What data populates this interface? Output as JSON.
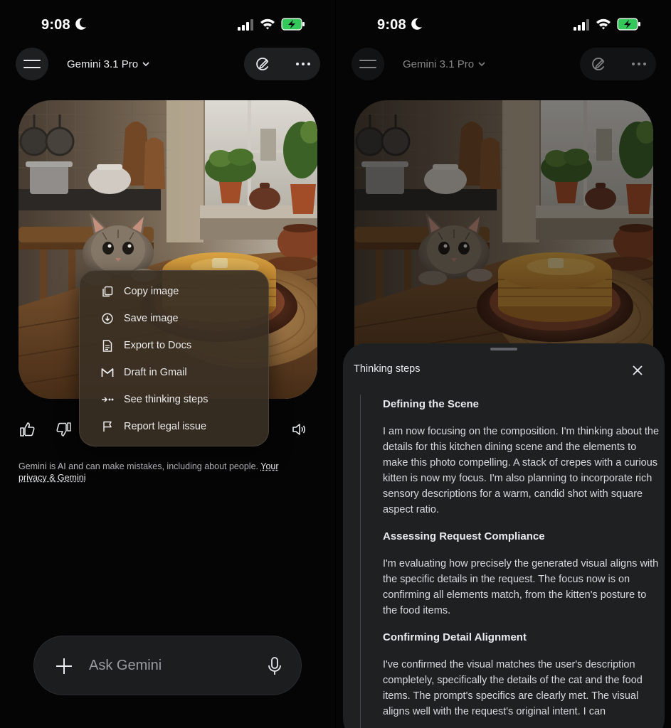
{
  "status_bar": {
    "time": "9:08"
  },
  "header": {
    "model_name": "Gemini 3.1 Pro"
  },
  "context_menu": {
    "items": [
      {
        "label": "Copy image",
        "icon": "copy-icon"
      },
      {
        "label": "Save image",
        "icon": "download-icon"
      },
      {
        "label": "Export to Docs",
        "icon": "docs-icon"
      },
      {
        "label": "Draft in Gmail",
        "icon": "gmail-icon"
      },
      {
        "label": "See thinking steps",
        "icon": "thinking-steps-icon"
      },
      {
        "label": "Report legal issue",
        "icon": "flag-icon"
      }
    ]
  },
  "disclaimer": {
    "text": "Gemini is AI and can make mistakes, including about people. ",
    "link_part1": "Your",
    "link_part2": "privacy & Gemini"
  },
  "input": {
    "placeholder": "Ask Gemini"
  },
  "thinking_sheet": {
    "title": "Thinking steps",
    "steps": [
      {
        "title": "Defining the Scene",
        "body": "I am now focusing on the composition. I'm thinking about the details for this kitchen dining scene and the elements to make this photo compelling. A stack of crepes with a curious kitten is now my focus. I'm also planning to incorporate rich sensory descriptions for a warm, candid shot with square aspect ratio."
      },
      {
        "title": "Assessing Request Compliance",
        "body": "I'm evaluating how precisely the generated visual aligns with the specific details in the request. The focus now is on confirming all elements match, from the kitten's posture to the food items."
      },
      {
        "title": "Confirming Detail Alignment",
        "body": "I've confirmed the visual matches the user's description completely, specifically the details of the cat and the food items. The prompt's specifics are clearly met. The visual aligns well with the request's original intent. I can"
      }
    ]
  },
  "colors": {
    "background": "#000000",
    "surface": "#1f2022",
    "menu_surface": "#3a3024",
    "text_primary": "#e8eaed"
  }
}
